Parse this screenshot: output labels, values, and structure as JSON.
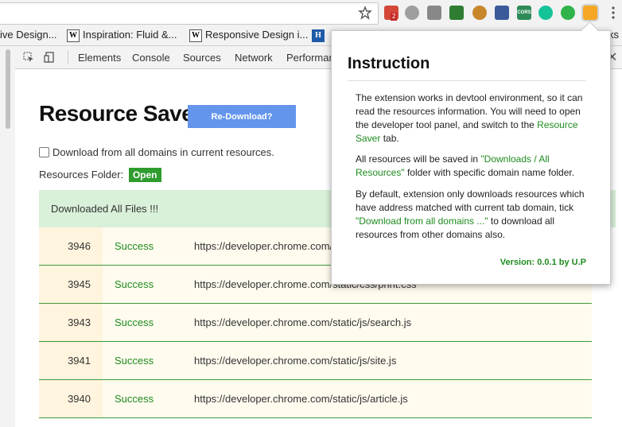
{
  "browser": {
    "extensions": [
      {
        "name": "gmail-icon",
        "color": "#d44638",
        "badge": "2"
      },
      {
        "name": "cloud-icon",
        "color": "#9e9e9e"
      },
      {
        "name": "camera-icon",
        "color": "#888888"
      },
      {
        "name": "screenshot-icon",
        "color": "#2e7d32"
      },
      {
        "name": "cookie-icon",
        "color": "#c8862b"
      },
      {
        "name": "eyedropper-icon",
        "color": "#3a5a9a"
      },
      {
        "name": "cors-icon",
        "color": "#2e8b57",
        "label": "CORS"
      },
      {
        "name": "grammarly-icon",
        "color": "#15c39a"
      },
      {
        "name": "play-icon",
        "color": "#2fb34a"
      },
      {
        "name": "resource-saver-icon",
        "color": "#f5a623"
      }
    ]
  },
  "bookmarks": [
    {
      "label": "ive Design..."
    },
    {
      "label": "Inspiration: Fluid &..."
    },
    {
      "label": "Responsive Design i..."
    },
    {
      "label": "ks"
    }
  ],
  "devtools": {
    "tabs": [
      "Elements",
      "Console",
      "Sources",
      "Network",
      "Performan"
    ]
  },
  "extension": {
    "title": "Resource Saver",
    "redownload_label": "Re-Download?",
    "all_domains_label": "Download from all domains in current resources.",
    "folder_label": "Resources Folder:",
    "open_label": "Open",
    "status_text": "Downloaded All Files !!!",
    "rows": [
      {
        "id": "3946",
        "status": "Success",
        "url": "https://developer.chrome.com/s"
      },
      {
        "id": "3945",
        "status": "Success",
        "url": "https://developer.chrome.com/static/css/print.css"
      },
      {
        "id": "3943",
        "status": "Success",
        "url": "https://developer.chrome.com/static/js/search.js"
      },
      {
        "id": "3941",
        "status": "Success",
        "url": "https://developer.chrome.com/static/js/site.js"
      },
      {
        "id": "3940",
        "status": "Success",
        "url": "https://developer.chrome.com/static/js/article.js"
      }
    ]
  },
  "popup": {
    "title": "Instruction",
    "p1_a": "The extension works in devtool environment, so it can read the resources information. You will need to open the developer tool panel, and switch to the ",
    "p1_link": "Resource Saver",
    "p1_b": " tab.",
    "p2_a": "All resources will be saved in ",
    "p2_link": "\"Downloads / All Resources\"",
    "p2_b": " folder with specific domain name folder.",
    "p3_a": "By default, extension only downloads resources which have address matched with current tab domain, tick ",
    "p3_link": "\"Download from all domains ...\"",
    "p3_b": " to download all resources from other domains also.",
    "version": "Version: 0.0.1 by U.P"
  }
}
